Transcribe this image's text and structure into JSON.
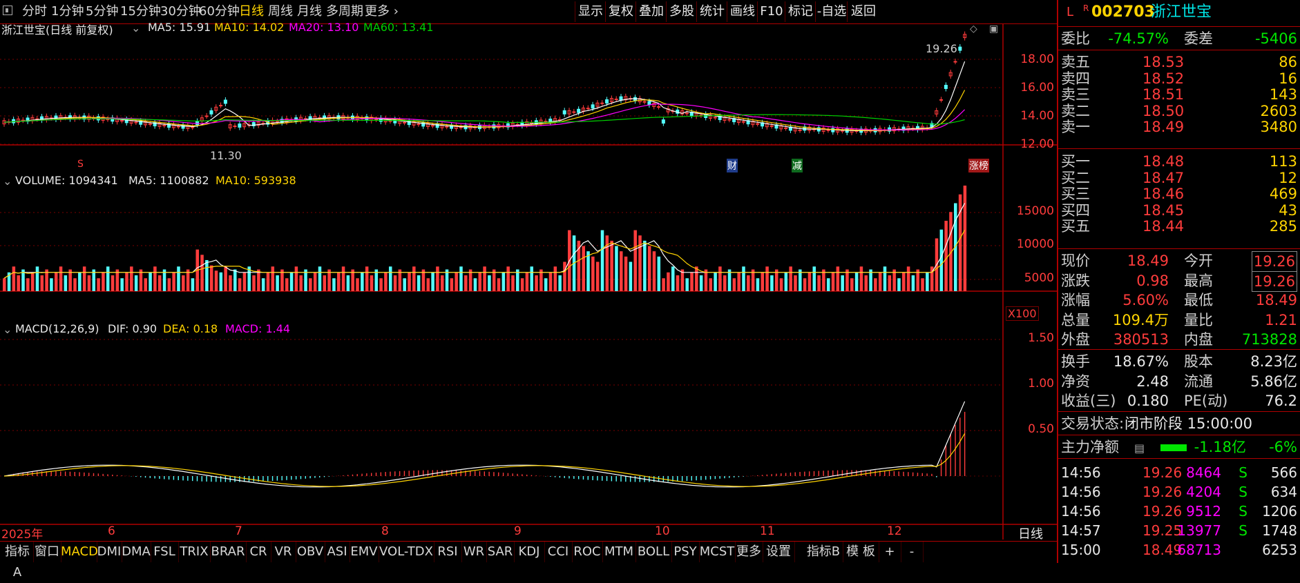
{
  "toolbar": {
    "periods": [
      "分时",
      "1分钟",
      "5分钟",
      "15分钟",
      "30分钟",
      "60分钟",
      "日线",
      "周线",
      "月线",
      "多周期",
      "更多"
    ],
    "active_period": "日线",
    "right_buttons": [
      "显示",
      "复权",
      "叠加",
      "多股",
      "统计",
      "画线",
      "F10",
      "标记",
      "-自选",
      "返回"
    ]
  },
  "kline": {
    "title": "浙江世宝(日线 前复权)",
    "ma5": "MA5: 15.91",
    "ma10": "MA10: 14.02",
    "ma20": "MA20: 13.10",
    "ma60": "MA60: 13.41",
    "yticks": [
      "18.00",
      "16.00",
      "14.00",
      "12.00"
    ],
    "high_label": "19.26",
    "low_label": "11.30",
    "markers": [
      "S",
      "财",
      "减",
      "涨榜"
    ]
  },
  "volume": {
    "title": "VOLUME: 1094341",
    "ma5": "MA5: 1100882",
    "ma10": "MA10: 593938",
    "yticks": [
      "15000",
      "10000",
      "5000"
    ],
    "unit": "X100"
  },
  "macd": {
    "title": "MACD(12,26,9)",
    "dif": "DIF: 0.90",
    "dea": "DEA: 0.18",
    "macd": "MACD: 1.44",
    "yticks": [
      "1.50",
      "1.00",
      "0.50"
    ]
  },
  "xaxis": {
    "labels": [
      "2025年",
      "6",
      "7",
      "8",
      "9",
      "10",
      "11",
      "12"
    ],
    "period_label": "日线"
  },
  "tabs": [
    "指标A",
    "窗口",
    "MACD",
    "DMI",
    "DMA",
    "FSL",
    "TRIX",
    "BRAR",
    "CR",
    "VR",
    "OBV",
    "ASI",
    "EMV",
    "VOL-TDX",
    "RSI",
    "WR",
    "SAR",
    "KDJ",
    "CCI",
    "ROC",
    "MTM",
    "BOLL",
    "PSY",
    "MCST",
    "更多",
    "设置",
    "指标B",
    "模 板",
    "+",
    "-"
  ],
  "active_tab": "MACD",
  "panel": {
    "flag_l": "L",
    "flag_r": "R",
    "code": "002703",
    "name": "浙江世宝",
    "weibi_label": "委比",
    "weibi": "-74.57%",
    "weicha_label": "委差",
    "weicha": "-5406",
    "asks": [
      {
        "label": "卖五",
        "price": "18.53",
        "vol": "86"
      },
      {
        "label": "卖四",
        "price": "18.52",
        "vol": "16"
      },
      {
        "label": "卖三",
        "price": "18.51",
        "vol": "143"
      },
      {
        "label": "卖二",
        "price": "18.50",
        "vol": "2603"
      },
      {
        "label": "卖一",
        "price": "18.49",
        "vol": "3480"
      }
    ],
    "bids": [
      {
        "label": "买一",
        "price": "18.48",
        "vol": "113"
      },
      {
        "label": "买二",
        "price": "18.47",
        "vol": "12"
      },
      {
        "label": "买三",
        "price": "18.46",
        "vol": "469"
      },
      {
        "label": "买四",
        "price": "18.45",
        "vol": "43"
      },
      {
        "label": "买五",
        "price": "18.44",
        "vol": "285"
      }
    ],
    "stats": [
      {
        "a": "现价",
        "b": "18.49",
        "c": "今开",
        "d": "19.26",
        "bc": "red",
        "dc": "red",
        "box": true
      },
      {
        "a": "涨跌",
        "b": "0.98",
        "c": "最高",
        "d": "19.26",
        "bc": "red",
        "dc": "red",
        "box": true
      },
      {
        "a": "涨幅",
        "b": "5.60%",
        "c": "最低",
        "d": "18.49",
        "bc": "red",
        "dc": "red",
        "box": false
      },
      {
        "a": "总量",
        "b": "109.4万",
        "c": "量比",
        "d": "1.21",
        "bc": "yellow",
        "dc": "red",
        "box": false
      },
      {
        "a": "外盘",
        "b": "380513",
        "c": "内盘",
        "d": "713828",
        "bc": "red",
        "dc": "green",
        "box": false
      }
    ],
    "stats2": [
      {
        "a": "换手",
        "b": "18.67%",
        "c": "股本",
        "d": "8.23亿"
      },
      {
        "a": "净资",
        "b": "2.48",
        "c": "流通",
        "d": "5.86亿"
      },
      {
        "a": "收益(三)",
        "b": "0.180",
        "c": "PE(动)",
        "d": "76.2"
      }
    ],
    "trade_state_label": "交易状态:",
    "trade_state": "闭市阶段 15:00:00",
    "flow_label": "主力净额",
    "flow_value": "-1.18亿",
    "flow_pct": "-6%",
    "ticks": [
      {
        "t": "14:56",
        "p": "19.26",
        "v": "8464",
        "s": "S",
        "n": "566"
      },
      {
        "t": "14:56",
        "p": "19.26",
        "v": "4204",
        "s": "S",
        "n": "634"
      },
      {
        "t": "14:56",
        "p": "19.26",
        "v": "9512",
        "s": "S",
        "n": "1206"
      },
      {
        "t": "14:57",
        "p": "19.25",
        "v": "13977",
        "s": "S",
        "n": "1748"
      },
      {
        "t": "15:00",
        "p": "18.49",
        "v": "68713",
        "s": "",
        "n": "6253"
      }
    ]
  },
  "colors": {
    "up": "#ff3c3c",
    "down": "#54ffff",
    "ma5": "#ffffff",
    "ma10": "#ffd400",
    "ma20": "#ff00ff",
    "ma60": "#00d000",
    "grid": "#7a0000"
  }
}
